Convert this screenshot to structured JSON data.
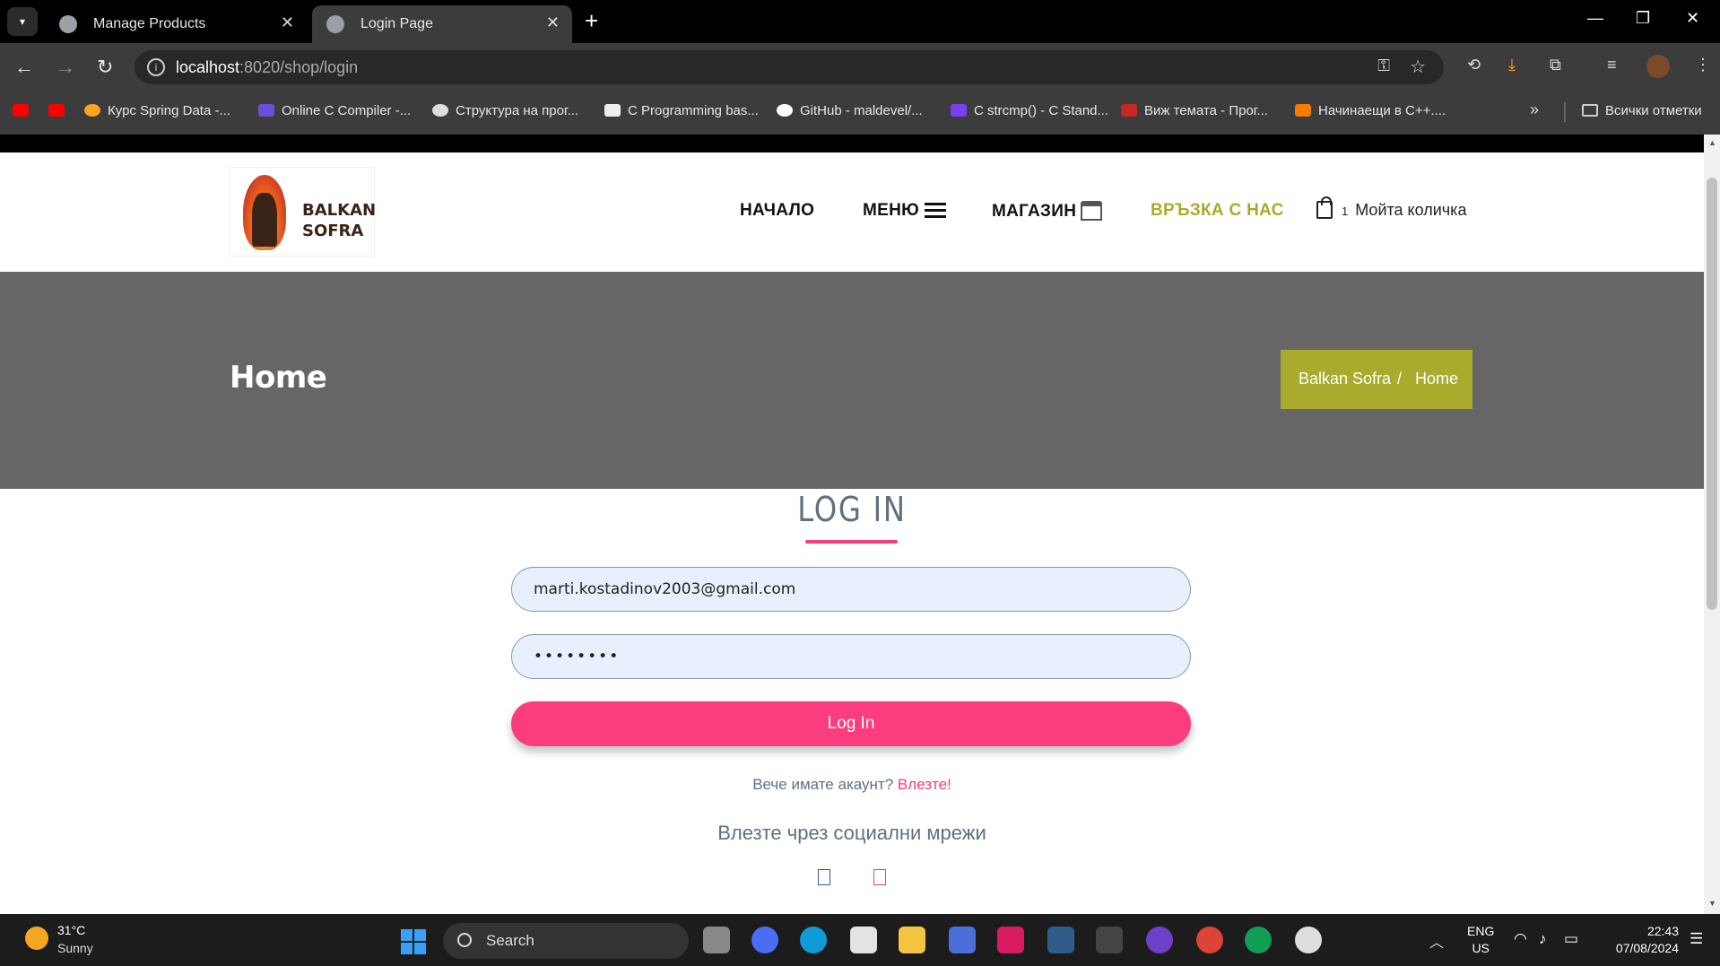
{
  "browser": {
    "tabs": [
      {
        "title": "Manage Products"
      },
      {
        "title": "Login Page"
      }
    ],
    "url_host": "localhost",
    "url_rest": ":8020/shop/login",
    "bookmarks": [
      "Курс Spring Data -...",
      "Online C Compiler -...",
      "Структура на прог...",
      "C Programming bas...",
      "GitHub - maldevel/...",
      "C strcmp() - C Stand...",
      "Виж темата - Прог...",
      "Начинаещи в C++...."
    ],
    "all_bookmarks": "Всички отметки"
  },
  "site": {
    "brand_line1": "BALKAN",
    "brand_line2": "SOFRA",
    "nav": {
      "home": "НАЧАЛО",
      "menu": "МЕНЮ",
      "shop": "МАГАЗИН",
      "contact": "ВРЪЗКА С НАС",
      "cart_count": "1",
      "cart_label": "Мойта количка"
    },
    "hero_title": "Home",
    "breadcrumb": {
      "parent": "Balkan Sofra",
      "separator": "/",
      "current": "Home"
    }
  },
  "login": {
    "title": "LOG IN",
    "email_value": "marti.kostadinov2003@gmail.com",
    "password_value": "••••••••",
    "button": "Log In",
    "have_account": "Вече имате акаунт?",
    "login_link": "Влезте!",
    "social_title": "Влезте чрез социални мрежи"
  },
  "taskbar": {
    "temperature": "31°C",
    "condition": "Sunny",
    "search": "Search",
    "lang1": "ENG",
    "lang2": "US",
    "time": "22:43",
    "date": "07/08/2024"
  },
  "colors": {
    "accent_olive": "#a9ab2c",
    "accent_pink": "#fb3d7f",
    "hero_gray": "#666666"
  }
}
